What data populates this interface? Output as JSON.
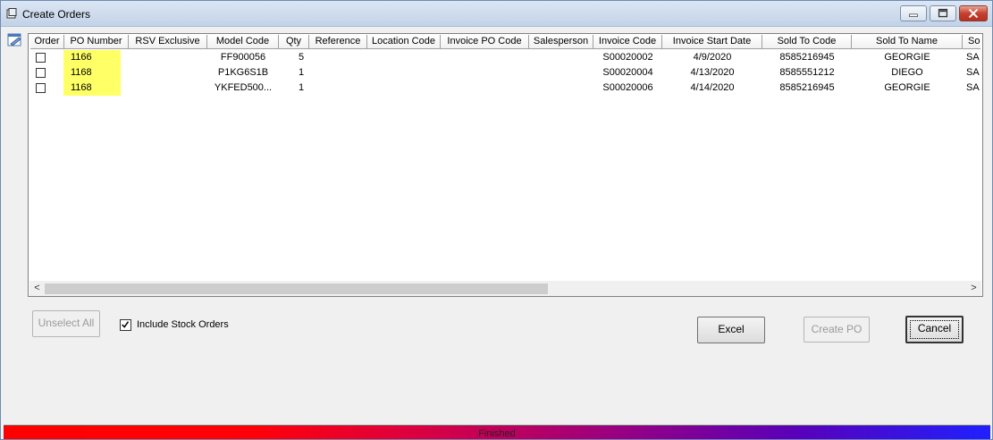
{
  "window": {
    "title": "Create Orders",
    "accent": "#ff0000"
  },
  "grid": {
    "columns": [
      "Order",
      "PO Number",
      "RSV Exclusive",
      "Model Code",
      "Qty",
      "Reference",
      "Location Code",
      "Invoice PO Code",
      "Salesperson",
      "Invoice Code",
      "Invoice Start Date",
      "Sold To Code",
      "Sold To Name",
      "So"
    ],
    "rows": [
      {
        "po": "1166",
        "model": "FF900056",
        "qty": "5",
        "invoice_code": "S00020002",
        "start_date": "4/9/2020",
        "sold_to_code": "8585216945",
        "sold_to_name": "GEORGIE",
        "so": "SA"
      },
      {
        "po": "1168",
        "model": "P1KG6S1B",
        "qty": "1",
        "invoice_code": "S00020004",
        "start_date": "4/13/2020",
        "sold_to_code": "8585551212",
        "sold_to_name": "DIEGO",
        "so": "SA"
      },
      {
        "po": "1168",
        "model": "YKFED500...",
        "qty": "1",
        "invoice_code": "S00020006",
        "start_date": "4/14/2020",
        "sold_to_code": "8585216945",
        "sold_to_name": "GEORGIE",
        "so": "SA"
      }
    ],
    "highlight_color": "#ffff66"
  },
  "scroll": {
    "left_arrow": "<",
    "right_arrow": ">"
  },
  "controls": {
    "unselect_all": "Unselect All",
    "include_stock_orders": "Include Stock Orders",
    "include_stock_checked": true,
    "excel": "Excel",
    "create_po": "Create PO",
    "cancel": "Cancel"
  },
  "status": {
    "text": "Finished"
  }
}
